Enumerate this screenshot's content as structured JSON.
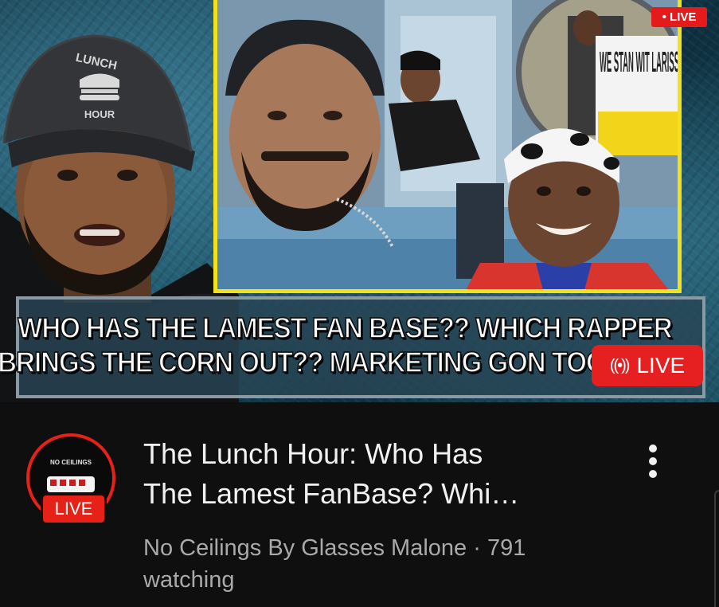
{
  "thumbnail": {
    "corner_live_label": "• LIVE",
    "caption_line1": "WHO HAS THE LAMEST FAN BASE?? WHICH RAPPER",
    "caption_line2": "BRINGS THE CORN OUT?? MARKETING GON TOO",
    "live_badge_icon": "((•))",
    "live_badge_label": "LIVE",
    "hat_text_top": "LUNCH",
    "hat_text_bottom": "HOUR",
    "sign_text": "WE STAN WIT LARISS",
    "icons": [
      "broadcast-icon",
      "burger-logo-icon"
    ]
  },
  "video": {
    "title_line1": "The Lunch Hour: Who Has",
    "title_line2": "The Lamest FanBase? Whi…",
    "channel": "No Ceilings By Glasses Malone",
    "separator": " · ",
    "viewers": "791",
    "viewers_suffix": "watching"
  },
  "channel_avatar": {
    "text": "NO CEILINGS",
    "live_label": "LIVE"
  },
  "menu": {
    "icon": "more-vert-icon"
  },
  "colors": {
    "live_red": "#e62117",
    "panel_border_yellow": "#f2e21c",
    "background": "#0f0f0f",
    "title_text": "#f1f1f1",
    "meta_text": "#aaaaaa"
  }
}
